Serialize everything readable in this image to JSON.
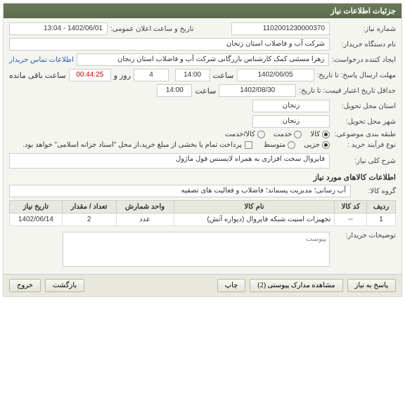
{
  "panel": {
    "title": "جزئیات اطلاعات نیاز"
  },
  "fields": {
    "need_number_label": "شماره نیاز:",
    "need_number": "1102001230000370",
    "announce_label": "تاریخ و ساعت اعلان عمومی:",
    "announce_value": "1402/06/01 - 13:04",
    "buyer_label": "نام دستگاه خریدار:",
    "buyer_value": "شرکت آب و فاضلاب استان زنجان",
    "requester_label": "ایجاد کننده درخواست:",
    "requester_value": "زهرا مسئنی کمک کارشناس بازرگانی شرکت آب و فاضلاب استان زنجان",
    "contact_link": "اطلاعات تماس خریدار",
    "deadline_label": "مهلت ارسال پاسخ: تا تاریخ:",
    "deadline_date": "1402/06/05",
    "deadline_hour_label": "ساعت",
    "deadline_hour": "14:00",
    "remain_prefix": "",
    "remain_days": "4",
    "remain_days_label": "روز و",
    "remain_time": "00:44:25",
    "remain_suffix": "ساعت باقی مانده",
    "validity_label": "حداقل تاریخ اعتبار قیمت: تا تاریخ:",
    "validity_date": "1402/08/30",
    "validity_hour_label": "ساعت",
    "validity_hour": "14:00",
    "province_label": "استان محل تحویل:",
    "province": "زنجان",
    "city_label": "شهر محل تحویل:",
    "city": "زنجان",
    "category_label": "طبقه بندی موضوعی:",
    "cat_goods": "کالا",
    "cat_service": "خدمت",
    "cat_goodsservice": "کالا/خدمت",
    "buy_type_label": "نوع فرآیند خرید :",
    "buy_partial": "جزیی",
    "buy_medium": "متوسط",
    "pay_note": "پرداخت تمام یا بخشی از مبلغ خرید،از محل \"اسناد خزانه اسلامی\" خواهد بود.",
    "desc_label": "شرح کلی نیاز:",
    "desc_value": "فایروال سخت افزاری به همراه لایسنس فول ماژول",
    "goods_section": "اطلاعات کالاهای مورد نیاز",
    "group_label": "گروه کالا:",
    "group_value": "آب رسانی؛ مدیریت پسماند؛ فاضلاب و فعالیت های تصفیه",
    "buyer_notes_label": "توضیحات خریدار:",
    "attach_label": "پیوست"
  },
  "table": {
    "headers": {
      "row": "ردیف",
      "code": "کد کالا",
      "name": "نام کالا",
      "unit": "واحد شمارش",
      "qty": "تعداد / مقدار",
      "date": "تاریخ نیاز"
    },
    "rows": [
      {
        "row": "1",
        "code": "--",
        "name": "تجهیزات امنیت شبکه فایروال (دیواره آتش)",
        "unit": "عدد",
        "qty": "2",
        "date": "1402/06/14"
      }
    ]
  },
  "footer": {
    "respond": "پاسخ به نیاز",
    "view_attach": "مشاهده مدارک پیوستی (2)",
    "print": "چاپ",
    "back": "بازگشت",
    "exit": "خروج"
  }
}
